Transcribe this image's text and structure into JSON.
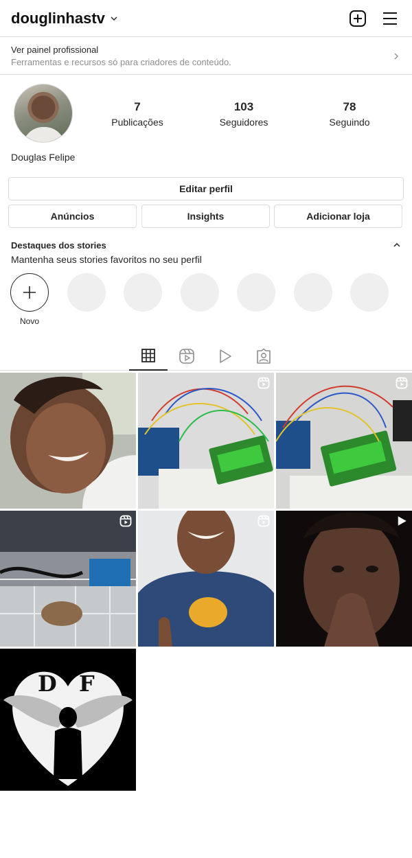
{
  "header": {
    "username": "douglinhastv",
    "new_post_icon": "add-square-icon",
    "menu_icon": "hamburger-menu-icon"
  },
  "pro_panel": {
    "title": "Ver painel profissional",
    "subtitle": "Ferramentas e recursos só para criadores de conteúdo."
  },
  "profile": {
    "name": "Douglas Felipe",
    "stats": [
      {
        "value": "7",
        "label": "Publicações"
      },
      {
        "value": "103",
        "label": "Seguidores"
      },
      {
        "value": "78",
        "label": "Seguindo"
      }
    ]
  },
  "buttons": {
    "edit": "Editar perfil",
    "ads": "Anúncios",
    "insights": "Insights",
    "shop": "Adicionar loja"
  },
  "highlights": {
    "title": "Destaques dos stories",
    "subtitle": "Mantenha seus stories favoritos no seu perfil",
    "new_label": "Novo",
    "empty_slots": 6
  },
  "tabs": [
    {
      "icon": "grid-icon",
      "active": true
    },
    {
      "icon": "reels-icon",
      "active": false
    },
    {
      "icon": "video-play-icon",
      "active": false
    },
    {
      "icon": "tagged-user-icon",
      "active": false
    }
  ],
  "posts": [
    {
      "subject": "selfie-smiling",
      "badge": ""
    },
    {
      "subject": "arduino-lcd-wires",
      "badge": "reels-icon"
    },
    {
      "subject": "arduino-lcd-wires-2",
      "badge": "reels-icon"
    },
    {
      "subject": "arduino-box-components",
      "badge": "reels-icon"
    },
    {
      "subject": "garfield-shirt-thumbs-up",
      "badge": "reels-icon"
    },
    {
      "subject": "night-selfie",
      "badge": "video-play-icon"
    },
    {
      "subject": "df-winged-logo",
      "badge": ""
    }
  ],
  "colors": {
    "text": "#262626",
    "muted": "#8e8e8e",
    "border": "#dbdbdb",
    "placeholder": "#efefef"
  }
}
